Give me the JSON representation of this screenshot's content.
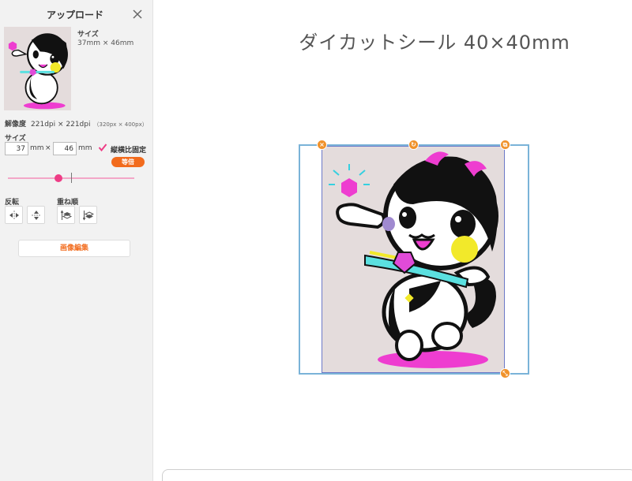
{
  "panel": {
    "title": "アップロード",
    "thumbnail": {
      "size_label": "サイズ",
      "size_value": "37mm × 46mm"
    },
    "resolution": {
      "label": "解像度",
      "value": "221dpi × 221dpi",
      "pixels": "（320px × 400px）"
    },
    "size_section": {
      "label": "サイズ",
      "width_value": "37",
      "height_value": "46",
      "unit": "mm",
      "times": "×",
      "lock_ratio_label": "縦横比固定",
      "lock_ratio_checked": true,
      "equal_button": "等倍"
    },
    "scale_slider": {
      "value_fraction": 0.4
    },
    "flip": {
      "label": "反転"
    },
    "order": {
      "label": "重ね順"
    },
    "edit_button": "画像編集"
  },
  "main": {
    "title": "ダイカットシール 40×40mm"
  },
  "colors": {
    "accent": "#f26b1d",
    "slider": "#ee3d86",
    "handle": "#f0922b",
    "frame": "#7ab3d8"
  },
  "icons": {
    "close": "close-icon",
    "check": "checkmark-icon",
    "flip_h": "flip-horizontal-icon",
    "flip_v": "flip-vertical-icon",
    "bring_front": "bring-forward-icon",
    "send_back": "send-backward-icon",
    "delete_handle": "delete-icon",
    "rotate_handle": "rotate-icon",
    "resize_handle": "resize-icon"
  }
}
